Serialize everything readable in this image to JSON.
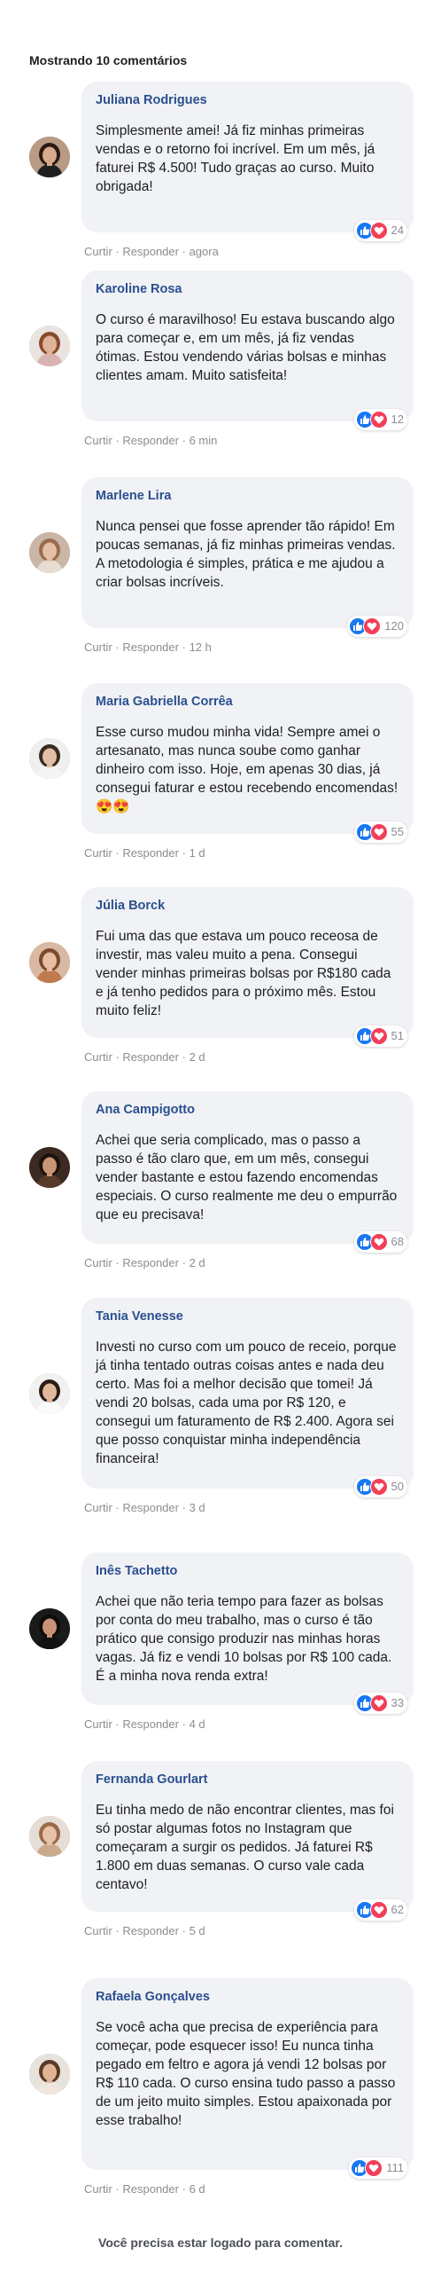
{
  "header": {
    "title": "Mostrando 10 comentários"
  },
  "labels": {
    "curtir": "Curtir",
    "responder": "Responder",
    "sep": "·"
  },
  "comments": [
    {
      "name": "Juliana Rodrigues",
      "text": "Simplesmente amei! Já fiz minhas primeiras vendas e o retorno foi incrível. Em um mês, já faturei R$ 4.500! Tudo graças ao curso. Muito obrigada!",
      "time": "agora",
      "count": "24",
      "avatar_colors": {
        "bg": "#b89a85",
        "hair": "#2a1a14",
        "skin": "#d8a98c",
        "shirt": "#1f1f1f"
      }
    },
    {
      "name": "Karoline Rosa",
      "text": "O curso é maravilhoso! Eu estava buscando algo para começar e, em um mês, já fiz vendas ótimas. Estou vendendo várias bolsas e minhas clientes amam. Muito satisfeita!",
      "time": "6 min",
      "count": "12",
      "avatar_colors": {
        "bg": "#e9e4e0",
        "hair": "#8a4a2c",
        "skin": "#e0b49a",
        "shirt": "#d9b2b2"
      }
    },
    {
      "name": "Marlene Lira",
      "text": "Nunca pensei que fosse aprender tão rápido! Em poucas semanas, já fiz minhas primeiras vendas. A metodologia é simples, prática e me ajudou a criar bolsas incríveis.",
      "time": "12 h",
      "count": "120",
      "avatar_colors": {
        "bg": "#c9b6a6",
        "hair": "#9b6b4c",
        "skin": "#e3c0a6",
        "shirt": "#e8ddd3"
      }
    },
    {
      "name": "Maria Gabriella Corrêa",
      "text": "Esse curso mudou minha vida! Sempre amei o artesanato, mas nunca soube como ganhar dinheiro com isso. Hoje, em apenas 30 dias, já consegui faturar e estou recebendo encomendas! 😍😍",
      "time": "1 d",
      "count": "55",
      "avatar_colors": {
        "bg": "#efefef",
        "hair": "#3a2a20",
        "skin": "#e2bfa6",
        "shirt": "#f5f5f5"
      }
    },
    {
      "name": "Júlia Borck",
      "text": "Fui uma das que estava um pouco receosa de investir, mas valeu muito a pena. Consegui vender minhas primeiras bolsas por R$180 cada e já tenho pedidos para o próximo mês. Estou muito feliz!",
      "time": "2 d",
      "count": "51",
      "avatar_colors": {
        "bg": "#d9b9a4",
        "hair": "#7b4a2c",
        "skin": "#e6bea1",
        "shirt": "#c07a4e"
      }
    },
    {
      "name": "Ana Campigotto",
      "text": "Achei que seria complicado, mas o passo a passo é tão claro que, em um mês, consegui vender bastante e estou fazendo encomendas especiais. O curso realmente me deu o empurrão que eu precisava!",
      "time": "2 d",
      "count": "68",
      "avatar_colors": {
        "bg": "#3a2a22",
        "hair": "#1e120c",
        "skin": "#c99576",
        "shirt": "#5a3b2a"
      }
    },
    {
      "name": "Tania Venesse",
      "text": "Investi no curso com um pouco de receio, porque já tinha tentado outras coisas antes e nada deu certo. Mas foi a melhor decisão que tomei! Já vendi 20 bolsas, cada uma por R$ 120, e consegui um faturamento de R$ 2.400. Agora sei que posso conquistar minha independência financeira!",
      "time": "3 d",
      "count": "50",
      "avatar_colors": {
        "bg": "#f1f1f1",
        "hair": "#2a1c14",
        "skin": "#e1b89c",
        "shirt": "#fafafa"
      }
    },
    {
      "name": "Inês Tachetto",
      "text": "Achei que não teria tempo para fazer as bolsas por conta do meu trabalho, mas o curso é tão prático que consigo produzir nas minhas horas vagas. Já fiz e vendi 10 bolsas por R$ 100 cada. É a minha nova renda extra!",
      "time": "4 d",
      "count": "33",
      "avatar_colors": {
        "bg": "#1a1a1a",
        "hair": "#0f0a08",
        "skin": "#c89278",
        "shirt": "#111111"
      }
    },
    {
      "name": "Fernanda Gourlart",
      "text": "Eu tinha medo de não encontrar clientes, mas foi só postar algumas fotos no Instagram que começaram a surgir os pedidos. Já faturei R$ 1.800 em duas semanas. O curso vale cada centavo!",
      "time": "5 d",
      "count": "62",
      "avatar_colors": {
        "bg": "#e6ddd6",
        "hair": "#9a6a48",
        "skin": "#e8c2a8",
        "shirt": "#caa98c"
      }
    },
    {
      "name": "Rafaela Gonçalves",
      "text": "Se você acha que precisa de experiência para começar, pode esquecer isso! Eu nunca tinha pegado em feltro e agora já vendi 12 bolsas por R$ 110 cada. O curso ensina tudo passo a passo de um jeito muito simples. Estou apaixonada por esse trabalho!",
      "time": "6 d",
      "count": "111",
      "avatar_colors": {
        "bg": "#e8e2dc",
        "hair": "#5a3a26",
        "skin": "#e0b596",
        "shirt": "#efe7df"
      }
    }
  ],
  "footer": {
    "text": "Você precisa estar logado para comentar."
  }
}
